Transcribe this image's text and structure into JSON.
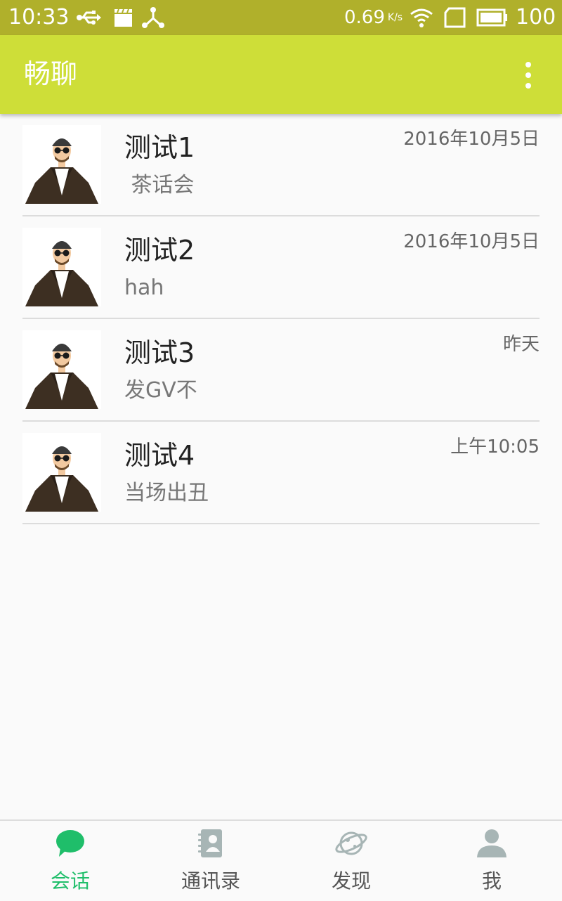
{
  "status_bar": {
    "time": "10:33",
    "speed": "0.69",
    "speed_unit": "K/s",
    "battery": "100",
    "icons": [
      "usb-icon",
      "clapper-icon",
      "share-hub-icon",
      "wifi-icon",
      "sim-card-icon",
      "battery-icon"
    ]
  },
  "app_bar": {
    "title": "畅聊",
    "background": "#cede38",
    "status_bar_background": "#b0b02b"
  },
  "conversations": [
    {
      "name": "测试1",
      "preview": " 茶话会",
      "time": "2016年10月5日"
    },
    {
      "name": "测试2",
      "preview": "hah",
      "time": "2016年10月5日"
    },
    {
      "name": "测试3",
      "preview": "发GV不",
      "time": "昨天"
    },
    {
      "name": "测试4",
      "preview": "当场出丑",
      "time": "上午10:05"
    }
  ],
  "bottom_nav": {
    "active_color": "#1fbe6a",
    "inactive_icon_color": "#a7b5b5",
    "items": [
      {
        "label": "会话",
        "icon": "chat-bubble-icon",
        "active": true
      },
      {
        "label": "通讯录",
        "icon": "contacts-book-icon",
        "active": false
      },
      {
        "label": "发现",
        "icon": "planet-icon",
        "active": false
      },
      {
        "label": "我",
        "icon": "person-icon",
        "active": false
      }
    ]
  }
}
